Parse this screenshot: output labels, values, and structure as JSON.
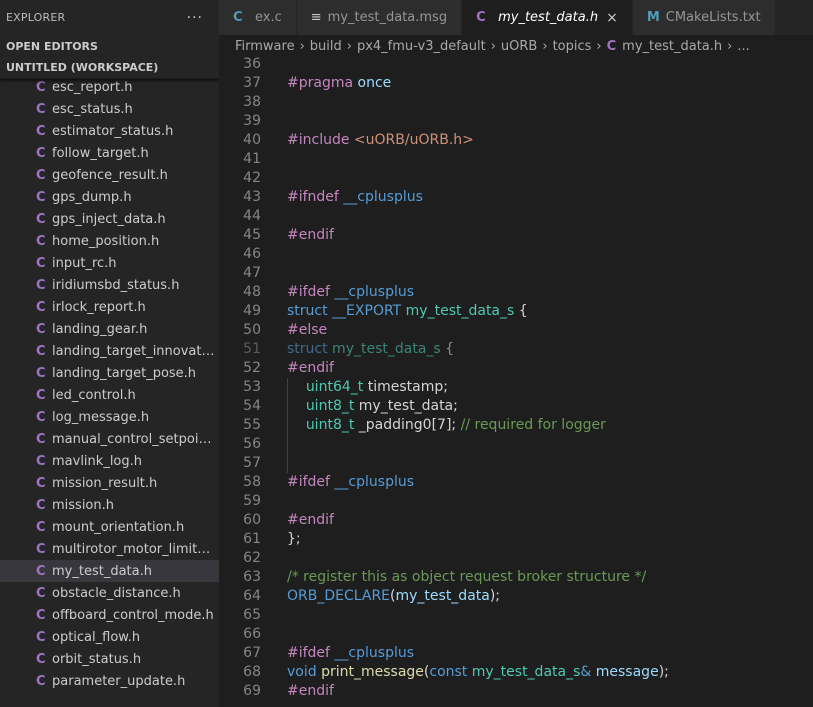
{
  "explorer": {
    "title": "EXPLORER",
    "more": "···",
    "open_editors": "OPEN EDITORS",
    "workspace": "UNTITLED (WORKSPACE)",
    "files": [
      "esc_report.h",
      "esc_status.h",
      "estimator_status.h",
      "follow_target.h",
      "geofence_result.h",
      "gps_dump.h",
      "gps_inject_data.h",
      "home_position.h",
      "input_rc.h",
      "iridiumsbd_status.h",
      "irlock_report.h",
      "landing_gear.h",
      "landing_target_innovatio...",
      "landing_target_pose.h",
      "led_control.h",
      "log_message.h",
      "manual_control_setpoint.h",
      "mavlink_log.h",
      "mission_result.h",
      "mission.h",
      "mount_orientation.h",
      "multirotor_motor_limits.h",
      "my_test_data.h",
      "obstacle_distance.h",
      "offboard_control_mode.h",
      "optical_flow.h",
      "orbit_status.h",
      "parameter_update.h"
    ],
    "active_file": "my_test_data.h"
  },
  "tabs": [
    {
      "label": "ex.c",
      "icon": "C"
    },
    {
      "label": "my_test_data.msg",
      "icon": "≡"
    },
    {
      "label": "my_test_data.h",
      "icon": "C",
      "active": true,
      "close": "×"
    },
    {
      "label": "CMakeLists.txt",
      "icon": "M"
    }
  ],
  "breadcrumb": [
    "Firmware",
    "build",
    "px4_fmu-v3_default",
    "uORB",
    "topics",
    "my_test_data.h",
    "..."
  ],
  "lines": {
    "n36": "36",
    "n37": "37",
    "n38": "38",
    "n39": "39",
    "n40": "40",
    "n41": "41",
    "n42": "42",
    "n43": "43",
    "n44": "44",
    "n45": "45",
    "n46": "46",
    "n47": "47",
    "n48": "48",
    "n49": "49",
    "n50": "50",
    "n51": "51",
    "n52": "52",
    "n53": "53",
    "n54": "54",
    "n55": "55",
    "n56": "56",
    "n57": "57",
    "n58": "58",
    "n59": "59",
    "n60": "60",
    "n61": "61",
    "n62": "62",
    "n63": "63",
    "n64": "64",
    "n65": "65",
    "n66": "66",
    "n67": "67",
    "n68": "68",
    "n69": "69"
  },
  "code": {
    "pragma": "#pragma",
    "once": " once",
    "include": "#include",
    "include_path": " <uORB/uORB.h>",
    "ifndef": "#ifndef",
    "cplusplus": " __cplusplus",
    "endif": "#endif",
    "ifdef": "#ifdef",
    "else": "#else",
    "struct": "struct",
    "export": " __EXPORT",
    "struct_name": " my_test_data_s",
    "brace_open": " {",
    "uint64": "uint64_t",
    "timestamp": " timestamp;",
    "uint8": "uint8_t",
    "my_test_data_field": " my_test_data;",
    "padding": " _padding0",
    "padding_idx": "[7];",
    "padding_comment": " // required for logger",
    "close_brace": "};",
    "comment_register": "/* register this as object request broker structure */",
    "orb_declare": "ORB_DECLARE",
    "orb_arg_open": "(",
    "orb_arg": "my_test_data",
    "orb_arg_close": ");",
    "void": "void",
    "print_message": " print_message",
    "paren_open": "(",
    "const": "const",
    "param_type": " my_test_data_s",
    "amp": "&",
    "param_name": " message",
    "paren_close": ");"
  },
  "colors": {
    "background": "#1e1e1e",
    "sidebar": "#252526",
    "keyword_purple": "#c586c0",
    "keyword_blue": "#569cd6",
    "string": "#ce9178",
    "type": "#4ec9b0",
    "comment": "#6a9955",
    "c_icon": "#a074c4"
  }
}
